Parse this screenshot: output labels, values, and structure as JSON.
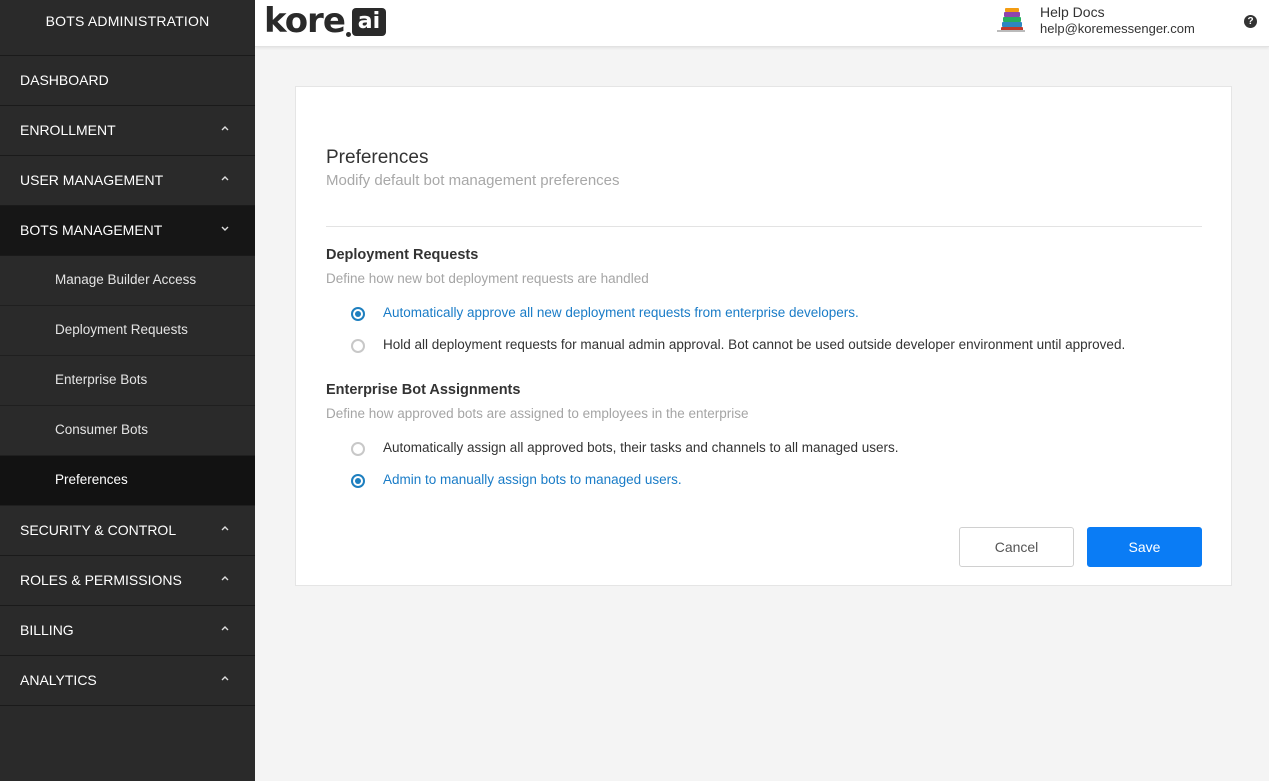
{
  "sidebar": {
    "title": "BOTS ADMINISTRATION",
    "items": [
      {
        "label": "DASHBOARD"
      },
      {
        "label": "ENROLLMENT"
      },
      {
        "label": "USER MANAGEMENT"
      },
      {
        "label": "BOTS MANAGEMENT"
      },
      {
        "label": "SECURITY & CONTROL"
      },
      {
        "label": "ROLES & PERMISSIONS"
      },
      {
        "label": "BILLING"
      },
      {
        "label": "ANALYTICS"
      }
    ],
    "sub_items": [
      {
        "label": "Manage Builder Access"
      },
      {
        "label": "Deployment Requests"
      },
      {
        "label": "Enterprise Bots"
      },
      {
        "label": "Consumer Bots"
      },
      {
        "label": "Preferences"
      }
    ]
  },
  "header": {
    "logo_text": "kore",
    "logo_suffix": "ai",
    "help_docs": "Help Docs",
    "email": "help@koremessenger.com",
    "help_icon": "?"
  },
  "main": {
    "title": "Preferences",
    "subtitle": "Modify default bot management preferences",
    "sections": [
      {
        "title": "Deployment Requests",
        "description": "Define how new bot deployment requests are handled",
        "options": [
          {
            "label": "Automatically approve all new deployment requests from enterprise developers.",
            "checked": true
          },
          {
            "label": "Hold all deployment requests for manual admin approval. Bot cannot be used outside developer environment until approved.",
            "checked": false
          }
        ]
      },
      {
        "title": "Enterprise Bot Assignments",
        "description": "Define how approved bots are assigned to employees in the enterprise",
        "options": [
          {
            "label": "Automatically assign all approved bots, their tasks and channels to all managed users.",
            "checked": false
          },
          {
            "label": "Admin to manually assign bots to managed users.",
            "checked": true
          }
        ]
      }
    ],
    "cancel_label": "Cancel",
    "save_label": "Save"
  },
  "colors": {
    "accent": "#0a7cf5",
    "selected_text": "#1a7cc7",
    "sidebar_bg": "#2a2a2a"
  }
}
